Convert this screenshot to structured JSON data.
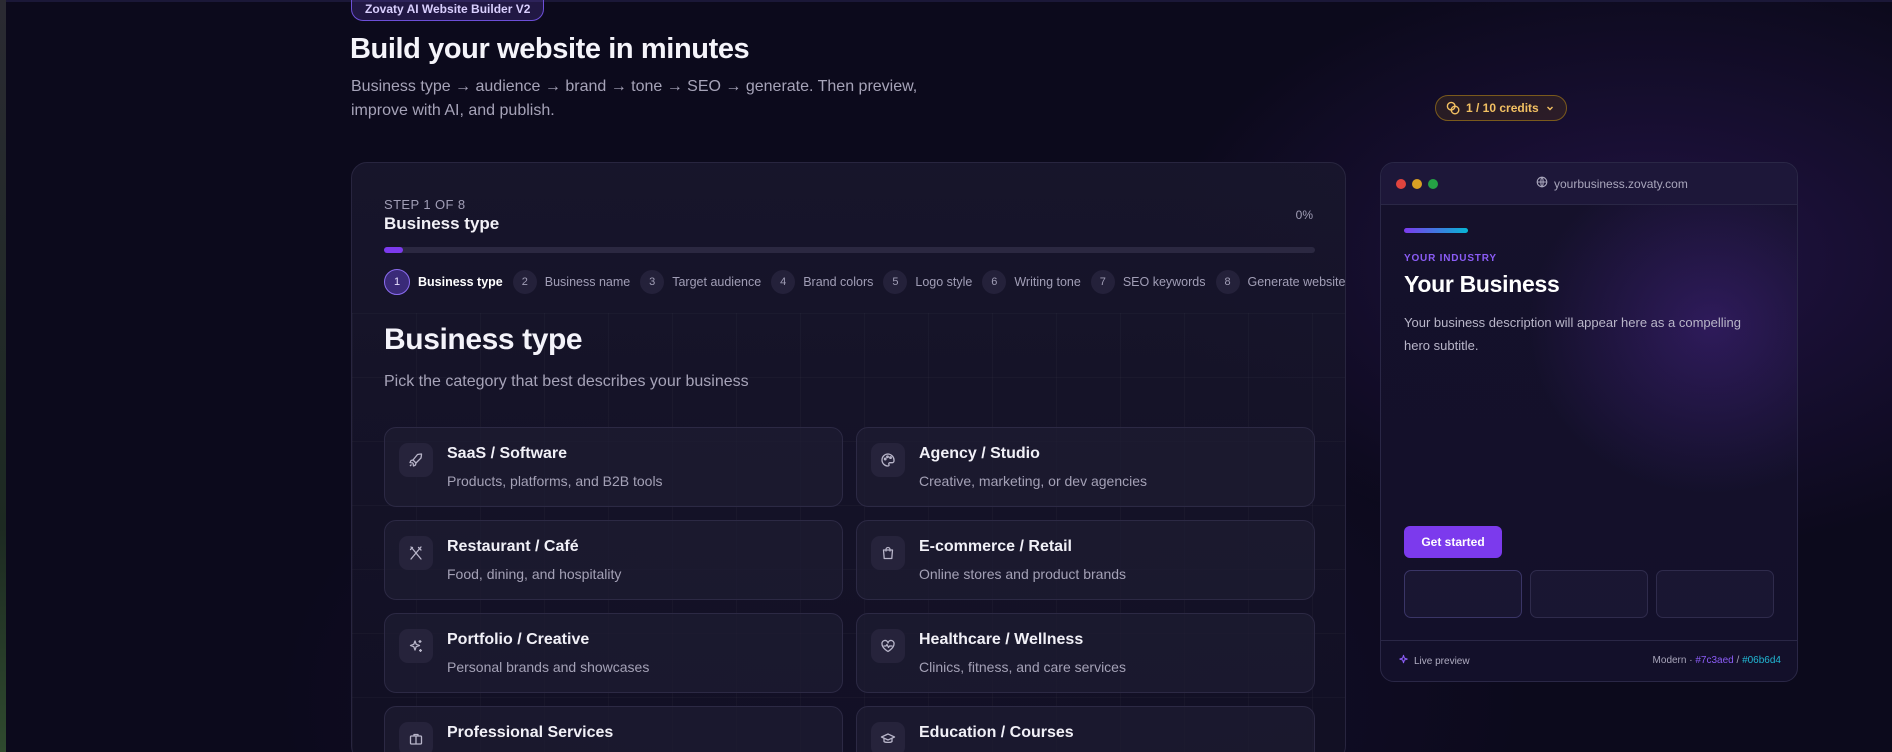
{
  "header": {
    "badge": "Zovaty AI Website Builder V2",
    "title": "Build your website in minutes",
    "subtitle": "Business type → audience → brand → tone → SEO → generate. Then preview, improve with AI, and publish.",
    "credits": "1 / 10 credits"
  },
  "wizard": {
    "step_of": "STEP 1 OF 8",
    "step_title": "Business type",
    "progress_text": "0%",
    "progress_value": 0.02,
    "steps": [
      {
        "num": "1",
        "label": "Business type"
      },
      {
        "num": "2",
        "label": "Business name"
      },
      {
        "num": "3",
        "label": "Target audience"
      },
      {
        "num": "4",
        "label": "Brand colors"
      },
      {
        "num": "5",
        "label": "Logo style"
      },
      {
        "num": "6",
        "label": "Writing tone"
      },
      {
        "num": "7",
        "label": "SEO keywords"
      },
      {
        "num": "8",
        "label": "Generate website"
      }
    ],
    "section_title": "Business type",
    "section_subtitle": "Pick the category that best describes your business",
    "options": [
      {
        "title": "SaaS / Software",
        "desc": "Products, platforms, and B2B tools",
        "icon": "rocket-icon"
      },
      {
        "title": "Agency / Studio",
        "desc": "Creative, marketing, or dev agencies",
        "icon": "palette-icon"
      },
      {
        "title": "Restaurant / Café",
        "desc": "Food, dining, and hospitality",
        "icon": "utensils-icon"
      },
      {
        "title": "E-commerce / Retail",
        "desc": "Online stores and product brands",
        "icon": "shopping-bag-icon"
      },
      {
        "title": "Portfolio / Creative",
        "desc": "Personal brands and showcases",
        "icon": "sparkles-icon"
      },
      {
        "title": "Healthcare / Wellness",
        "desc": "Clinics, fitness, and care services",
        "icon": "heart-pulse-icon"
      },
      {
        "title": "Professional Services",
        "desc": "",
        "icon": "briefcase-icon"
      },
      {
        "title": "Education / Courses",
        "desc": "",
        "icon": "graduation-cap-icon"
      }
    ]
  },
  "preview": {
    "url": "yourbusiness.zovaty.com",
    "industry": "YOUR INDUSTRY",
    "title": "Your Business",
    "description": "Your business description will appear here as a compelling hero subtitle.",
    "cta": "Get started",
    "live_label": "Live preview",
    "theme_label": "Modern · ",
    "color_primary": "#7c3aed",
    "color_separator": " / ",
    "color_secondary": "#06b6d4"
  },
  "colors": {
    "accent": "#7c3aed",
    "secondary": "#06b6d4",
    "credits": "#f2c062",
    "dot_red": "#e0443e",
    "dot_yellow": "#d9a023",
    "dot_green": "#25a145"
  }
}
